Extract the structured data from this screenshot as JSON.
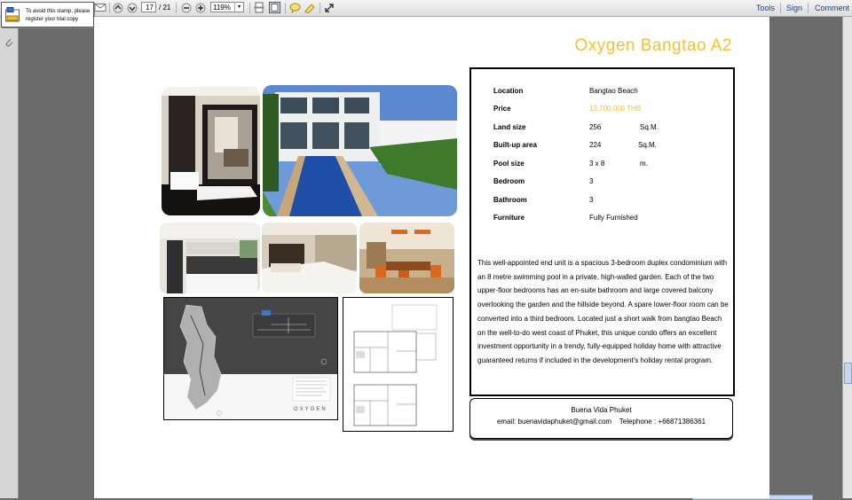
{
  "stamp": {
    "text": "To avoid this stamp, please register your trial copy"
  },
  "toolbar": {
    "current_page": "17",
    "total_pages": "/ 21",
    "zoom": "119%",
    "tools": "Tools",
    "sign": "Sign",
    "comment": "Comment"
  },
  "listing": {
    "title": "Oxygen Bangtao A2",
    "details": [
      {
        "label": "Location",
        "value": "Bangtao Beach",
        "unit": ""
      },
      {
        "label": "Price",
        "value": "13,700,000 THB",
        "unit": ""
      },
      {
        "label": "Land size",
        "value": "256",
        "unit": "Sq.M."
      },
      {
        "label": "Built-up area",
        "value": "224",
        "unit": "Sq.M."
      },
      {
        "label": "Pool size",
        "value": "3 x 8",
        "unit": "m."
      },
      {
        "label": "Bedroom",
        "value": "3",
        "unit": ""
      },
      {
        "label": "Bathroom",
        "value": "3",
        "unit": ""
      },
      {
        "label": "Furniture",
        "value": "Fully Furnished",
        "unit": ""
      }
    ],
    "description": "This well-appointed end unit is a spacious 3-bedroom duplex condominium with an 8 metre swimming pool in a private, high-walled garden. Each of the two upper-floor bedrooms has an en-suite bathroom and large covered balcony overlooking the garden and the hillside beyond. A spare lower-floor room can be converted into a third bedroom. Located just a short walk from bangtao Beach  on the well-to-do west coast of Phuket, this unique condo offers an excellent investment opportunity in a trendy, fully-equipped holiday home with attractive guaranteed returns if included in the development's holiday rental program.",
    "price_color": "#f2c233"
  },
  "contact": {
    "company": "Buena Vida Phuket",
    "line": "email: buenavidaphuket@gmail.com    Telephone : +66871386361"
  },
  "map": {
    "brand": "OXYGEN"
  }
}
